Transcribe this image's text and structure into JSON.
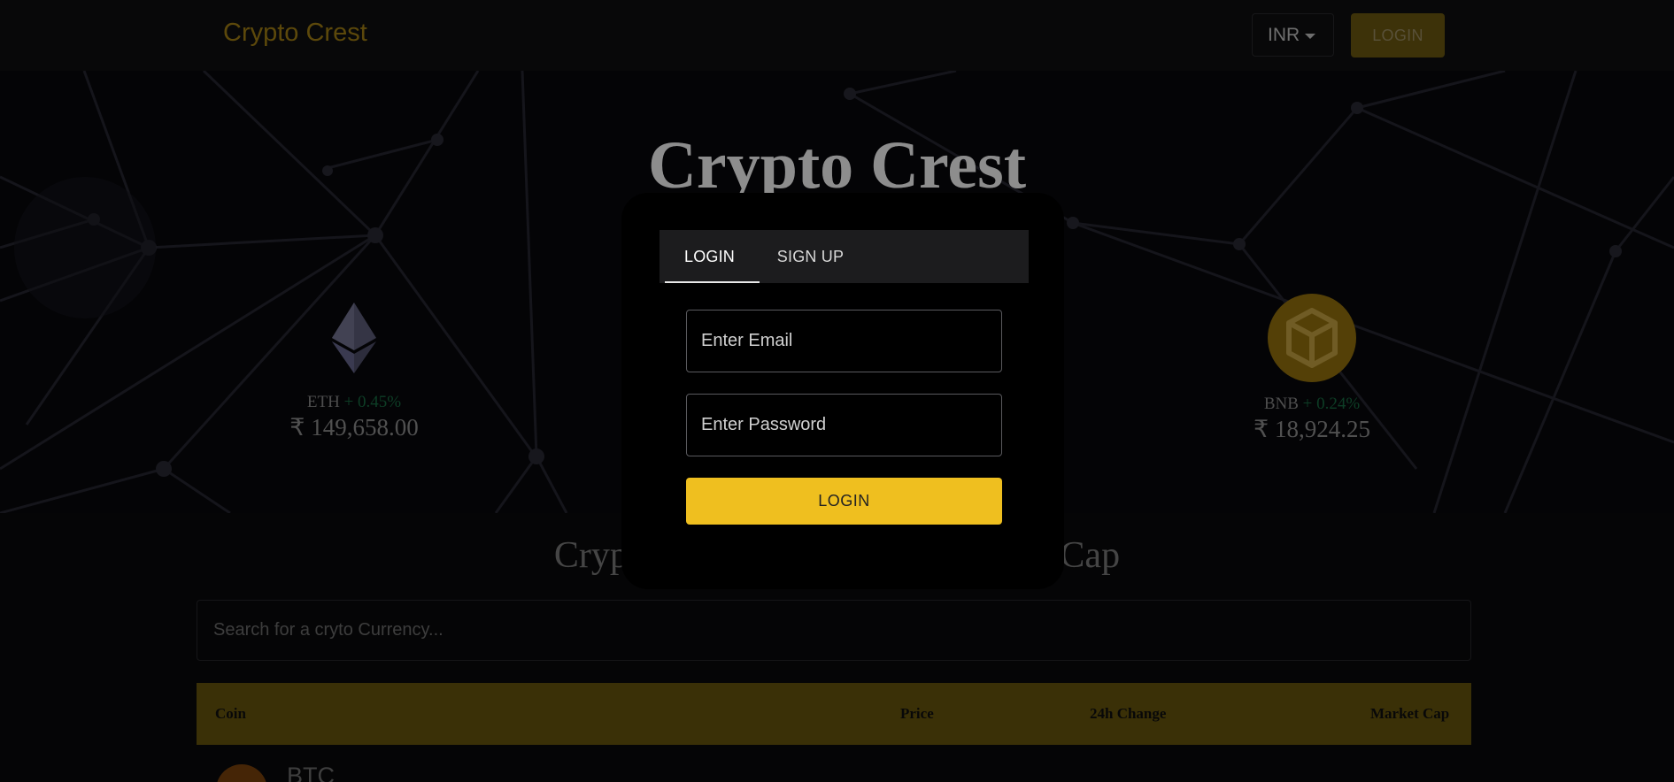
{
  "header": {
    "brand": "Crypto Crest",
    "currency": "INR",
    "login_label": "LOGIN"
  },
  "hero": {
    "title": "Crypto Crest",
    "coins": [
      {
        "symbol": "ETH",
        "change": "+ 0.45%",
        "price": "₹ 149,658.00",
        "icon": "ethereum-icon"
      },
      {
        "symbol": "BNB",
        "change": "+ 0.24%",
        "price": "₹ 18,924.25",
        "icon": "bnb-icon"
      }
    ]
  },
  "section": {
    "title": "Cryptocurrency Prices by Market Cap",
    "search_placeholder": "Search for a cryto Currency..."
  },
  "table": {
    "columns": [
      "Coin",
      "Price",
      "24h Change",
      "Market Cap"
    ],
    "rows": [
      {
        "symbol": "BTC",
        "icon": "bitcoin-icon"
      }
    ]
  },
  "modal": {
    "tabs": [
      "LOGIN",
      "SIGN UP"
    ],
    "active_tab": "LOGIN",
    "email_placeholder": "Enter Email",
    "password_placeholder": "Enter Password",
    "submit_label": "LOGIN"
  },
  "colors": {
    "accent": "#efbf1f",
    "brand": "#b89116",
    "positive": "#1a7a4a"
  }
}
